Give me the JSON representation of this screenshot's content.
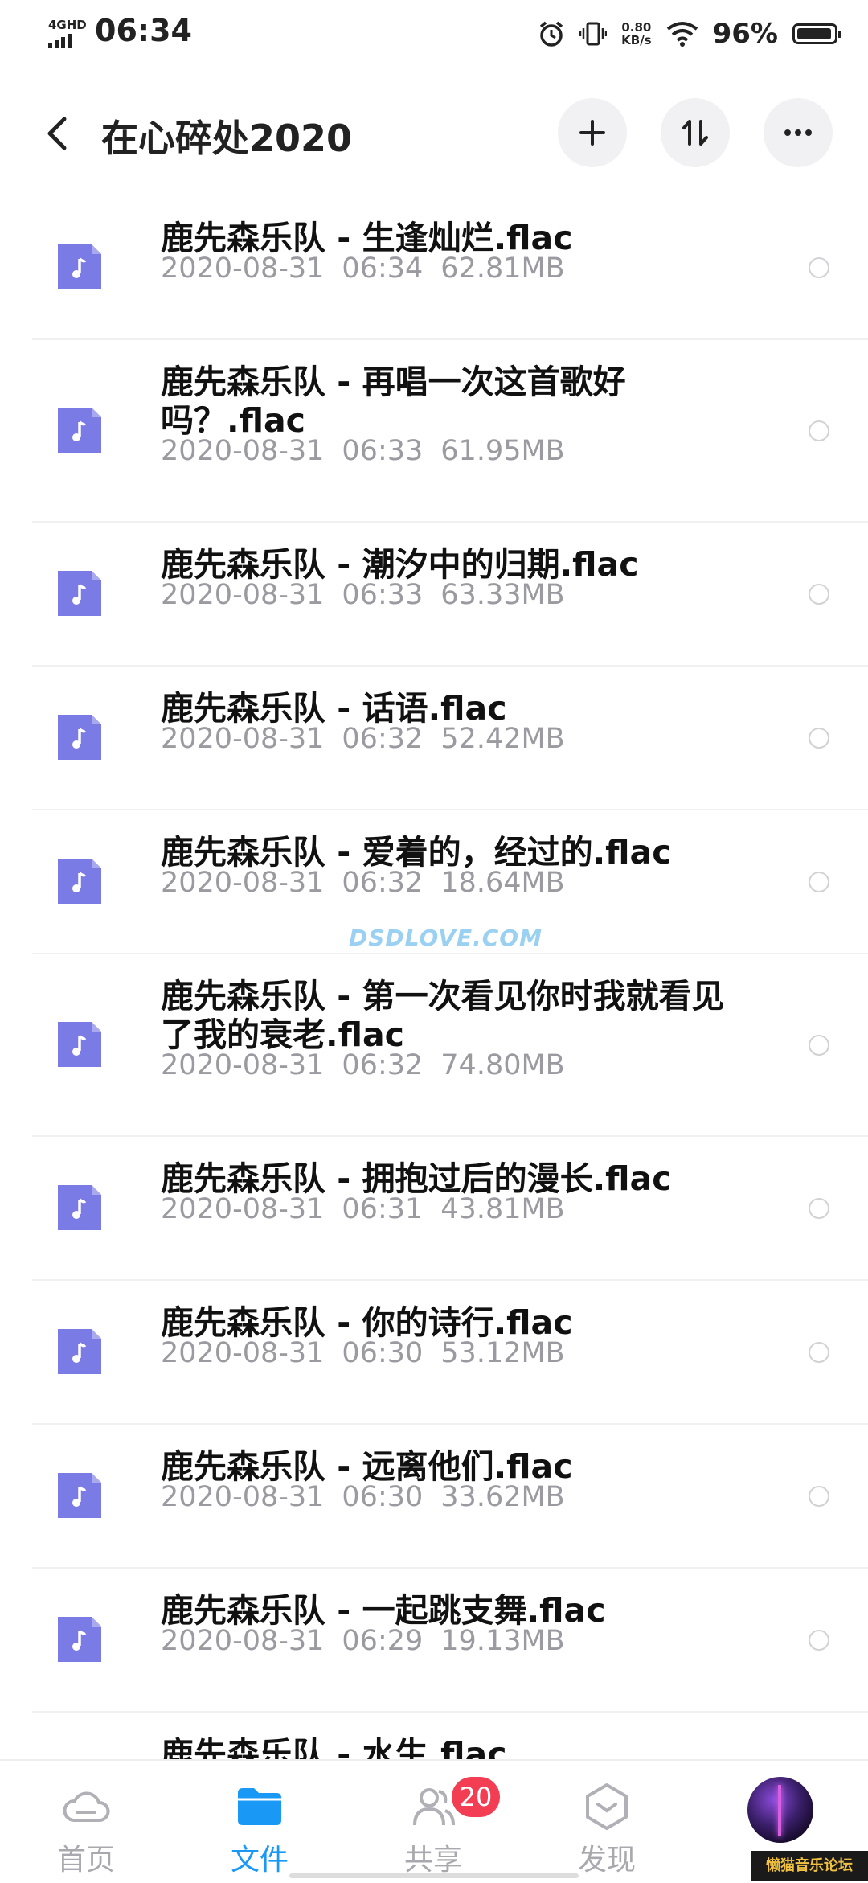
{
  "status_bar": {
    "network": "4GHD",
    "time": "06:34",
    "speed_value": "0.80",
    "speed_unit": "KB/s",
    "battery_pct": "96%",
    "battery_level": 0.96
  },
  "header": {
    "title": "在心碎处2020",
    "icons": [
      "back-icon",
      "plus-icon",
      "sort-icon",
      "more-icon"
    ]
  },
  "files": [
    {
      "name": "鹿先森乐队 - 生逢灿烂.flac",
      "date": "2020-08-31",
      "time": "06:34",
      "size": "62.81MB"
    },
    {
      "name": "鹿先森乐队 - 再唱一次这首歌好吗？.flac",
      "date": "2020-08-31",
      "time": "06:33",
      "size": "61.95MB"
    },
    {
      "name": "鹿先森乐队 - 潮汐中的归期.flac",
      "date": "2020-08-31",
      "time": "06:33",
      "size": "63.33MB"
    },
    {
      "name": "鹿先森乐队 - 话语.flac",
      "date": "2020-08-31",
      "time": "06:32",
      "size": "52.42MB"
    },
    {
      "name": "鹿先森乐队 - 爱着的，经过的.flac",
      "date": "2020-08-31",
      "time": "06:32",
      "size": "18.64MB"
    },
    {
      "name": "鹿先森乐队 - 第一次看见你时我就看见了我的衰老.flac",
      "date": "2020-08-31",
      "time": "06:32",
      "size": "74.80MB"
    },
    {
      "name": "鹿先森乐队 - 拥抱过后的漫长.flac",
      "date": "2020-08-31",
      "time": "06:31",
      "size": "43.81MB"
    },
    {
      "name": "鹿先森乐队 - 你的诗行.flac",
      "date": "2020-08-31",
      "time": "06:30",
      "size": "53.12MB"
    },
    {
      "name": "鹿先森乐队 - 远离他们.flac",
      "date": "2020-08-31",
      "time": "06:30",
      "size": "33.62MB"
    },
    {
      "name": "鹿先森乐队 - 一起跳支舞.flac",
      "date": "2020-08-31",
      "time": "06:29",
      "size": "19.13MB"
    },
    {
      "name": "鹿先森乐队 - 水生.flac",
      "date": "",
      "time": "",
      "size": ""
    }
  ],
  "watermark": "DSDLOVE.COM",
  "bottom_nav": {
    "tabs": [
      {
        "label": "首页",
        "icon": "cloud-icon"
      },
      {
        "label": "文件",
        "icon": "folder-icon"
      },
      {
        "label": "共享",
        "icon": "people-icon"
      },
      {
        "label": "发现",
        "icon": "discover-icon"
      }
    ],
    "share_badge": "20",
    "active_color": "#1a98f5",
    "inactive_color": "#a8a8ae"
  },
  "forum_stamp": "懒猫音乐论坛",
  "accent_colors": {
    "file_icon": "#7b7be6",
    "badge": "#f23d52"
  }
}
